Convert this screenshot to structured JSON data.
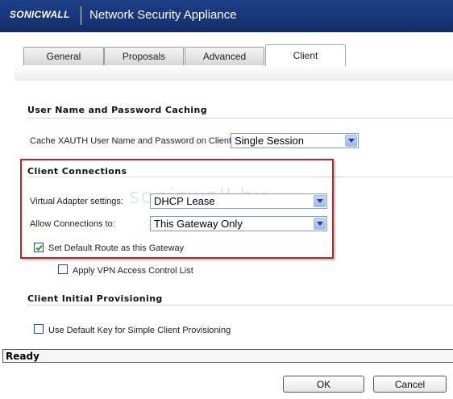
{
  "header": {
    "logo_text": "SONICWALL",
    "title": "Network Security Appliance"
  },
  "tabs": [
    {
      "label": "General",
      "active": false
    },
    {
      "label": "Proposals",
      "active": false
    },
    {
      "label": "Advanced",
      "active": false
    },
    {
      "label": "Client",
      "active": true
    }
  ],
  "caching": {
    "title": "User Name and Password Caching",
    "cache_label": "Cache XAUTH User Name and Password on Client:",
    "cache_value": "Single Session"
  },
  "connections": {
    "title": "Client Connections",
    "adapter_label": "Virtual Adapter settings:",
    "adapter_value": "DHCP Lease",
    "allow_label": "Allow Connections to:",
    "allow_value": "This Gateway Only",
    "default_route_label": "Set Default Route as this Gateway",
    "default_route_checked": true,
    "acl_label": "Apply VPN Access Control List",
    "acl_checked": false,
    "watermark": "sonicwall.hu"
  },
  "provisioning": {
    "title": "Client Initial Provisioning",
    "default_key_label": "Use Default Key for Simple Client Provisioning",
    "default_key_checked": false
  },
  "status": {
    "text": "Ready"
  },
  "buttons": {
    "ok": "OK",
    "cancel": "Cancel"
  },
  "colors": {
    "header_bg": "#173676",
    "highlight_border": "#b8262b",
    "select_border": "#7f9db9"
  }
}
